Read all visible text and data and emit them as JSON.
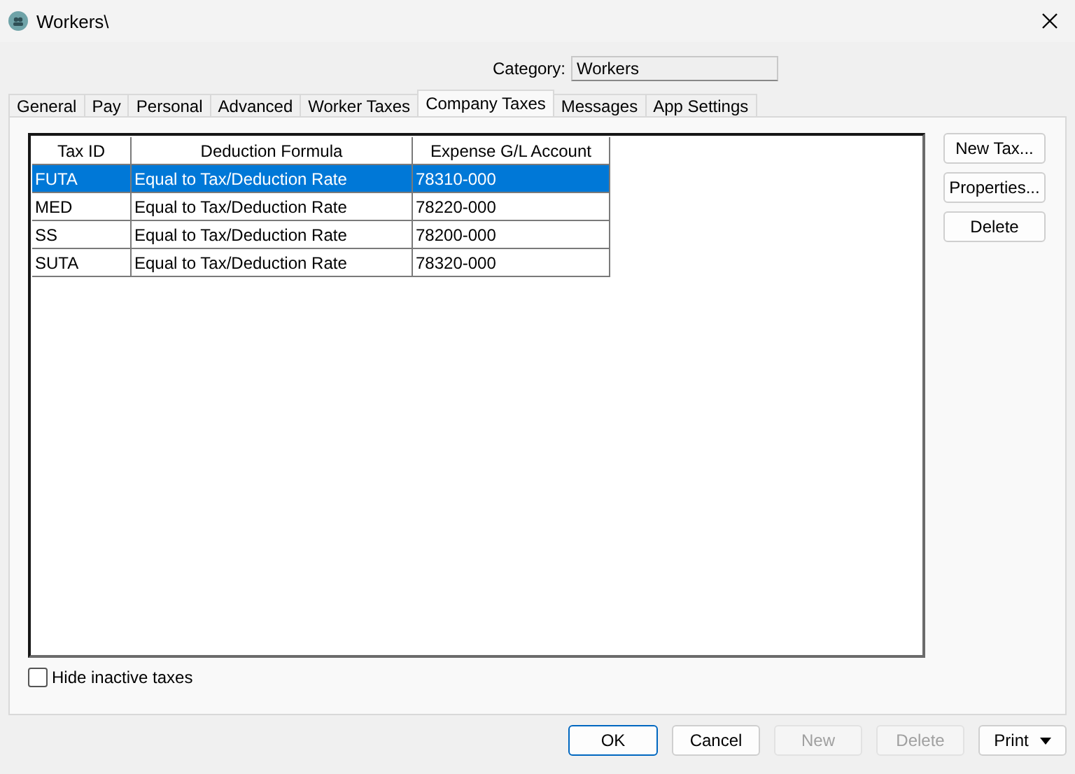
{
  "window": {
    "title": "Workers\\"
  },
  "category": {
    "label": "Category:",
    "value": "Workers"
  },
  "tabs": [
    {
      "label": "General",
      "selected": false
    },
    {
      "label": "Pay",
      "selected": false
    },
    {
      "label": "Personal",
      "selected": false
    },
    {
      "label": "Advanced",
      "selected": false
    },
    {
      "label": "Worker Taxes",
      "selected": false
    },
    {
      "label": "Company Taxes",
      "selected": true
    },
    {
      "label": "Messages",
      "selected": false
    },
    {
      "label": "App Settings",
      "selected": false
    }
  ],
  "table": {
    "columns": [
      "Tax ID",
      "Deduction Formula",
      "Expense G/L Account"
    ],
    "rows": [
      {
        "cells": [
          "FUTA",
          "Equal to Tax/Deduction Rate",
          "78310-000"
        ],
        "selected": true
      },
      {
        "cells": [
          "MED",
          "Equal to Tax/Deduction Rate",
          "78220-000"
        ],
        "selected": false
      },
      {
        "cells": [
          "SS",
          "Equal to Tax/Deduction Rate",
          "78200-000"
        ],
        "selected": false
      },
      {
        "cells": [
          "SUTA",
          "Equal to Tax/Deduction Rate",
          "78320-000"
        ],
        "selected": false
      }
    ]
  },
  "side_buttons": [
    "New Tax...",
    "Properties...",
    "Delete"
  ],
  "hide_inactive": {
    "label": "Hide inactive taxes",
    "checked": false
  },
  "footer_buttons": [
    {
      "label": "OK",
      "disabled": false,
      "default": true
    },
    {
      "label": "Cancel",
      "disabled": false,
      "default": false
    },
    {
      "label": "New",
      "disabled": true,
      "default": false
    },
    {
      "label": "Delete",
      "disabled": true,
      "default": false
    },
    {
      "label": "Print",
      "disabled": false,
      "default": false,
      "dropdown": true
    }
  ]
}
